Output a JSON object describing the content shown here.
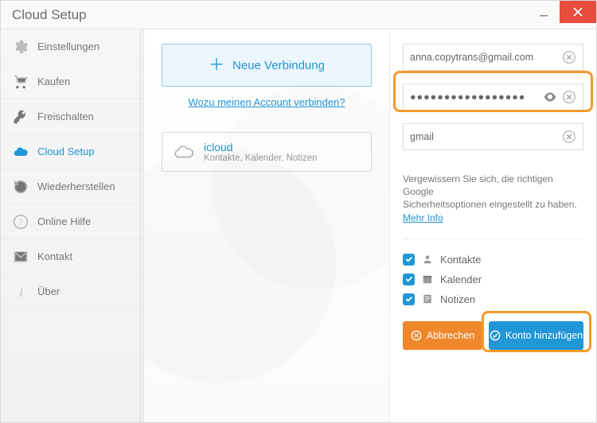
{
  "window": {
    "title": "Cloud Setup"
  },
  "sidebar": {
    "items": [
      {
        "label": "Einstellungen"
      },
      {
        "label": "Kaufen"
      },
      {
        "label": "Freischalten"
      },
      {
        "label": "Cloud Setup"
      },
      {
        "label": "Wiederherstellen"
      },
      {
        "label": "Online Hilfe"
      },
      {
        "label": "Kontakt"
      },
      {
        "label": "Über"
      }
    ]
  },
  "center": {
    "new_connection": "Neue Verbindung",
    "why_link": "Wozu meinen Account verbinden?",
    "card": {
      "title": "icloud",
      "subtitle": "Kontakte, Kalender, Notizen"
    }
  },
  "form": {
    "email": "anna.copytrans@gmail.com",
    "password": "●●●●●●●●●●●●●●●●●",
    "service": "gmail",
    "hint_line1": "Vergewissern Sie sich, die richtigen Google",
    "hint_line2": "Sicherheitsoptionen eingestellt zu haben.",
    "hint_link": "Mehr Info",
    "options": [
      {
        "label": "Kontakte"
      },
      {
        "label": "Kalender"
      },
      {
        "label": "Notizen"
      }
    ],
    "cancel": "Abbrechen",
    "submit": "Konto hinzufügen"
  }
}
